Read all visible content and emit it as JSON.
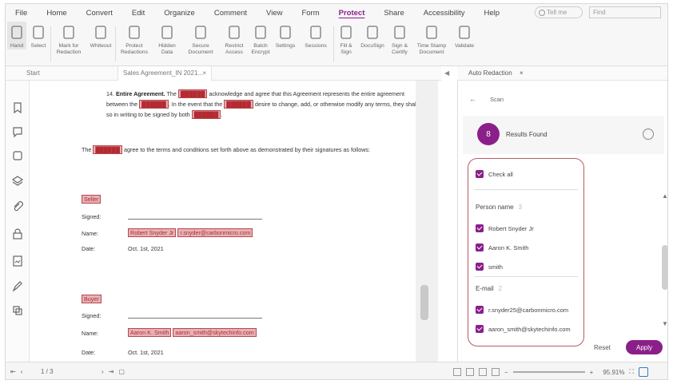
{
  "menu": [
    "File",
    "Home",
    "Convert",
    "Edit",
    "Organize",
    "Comment",
    "View",
    "Form",
    "Protect",
    "Share",
    "Accessibility",
    "Help"
  ],
  "menu_active": "Protect",
  "search_pill": "Tell me",
  "find_placeholder": "Find",
  "toolbar": [
    {
      "label": "Hand",
      "name": "hand-tool"
    },
    {
      "label": "Select",
      "name": "select-tool"
    },
    {
      "label": "Mark for\nRedaction",
      "name": "mark-redaction-tool"
    },
    {
      "label": "Whiteout",
      "name": "whiteout-tool"
    },
    {
      "label": "Protect\nRedactions",
      "name": "protect-redactions-tool"
    },
    {
      "label": "Hidden\nData",
      "name": "hidden-data-tool"
    },
    {
      "label": "Secure\nDocument",
      "name": "secure-document-tool"
    },
    {
      "label": "Restrict\nAccess",
      "name": "restrict-access-tool"
    },
    {
      "label": "Batch\nEncrypt",
      "name": "batch-encrypt-tool"
    },
    {
      "label": "Settings",
      "name": "settings-tool"
    },
    {
      "label": "Sessions",
      "name": "sessions-tool"
    },
    {
      "label": "Fill &\nSign",
      "name": "fill-sign-tool"
    },
    {
      "label": "DocuSign",
      "name": "docusign-tool"
    },
    {
      "label": "Sign &\nCertify",
      "name": "sign-certify-tool"
    },
    {
      "label": "Time Stamp\nDocument",
      "name": "time-stamp-tool"
    },
    {
      "label": "Validate",
      "name": "validate-tool"
    }
  ],
  "tabs": {
    "start": "Start",
    "doc": "Sales Agreement_IN 2021...",
    "close": "×"
  },
  "document": {
    "para_num": "14.",
    "para_title": "Entire Agreement.",
    "para_t1": " The ",
    "para_r1": "██████",
    "para_t2": " acknowledge and agree that this Agreement represents the entire agreement between the ",
    "para_r2": "██████",
    "para_t3": ". In the event that the ",
    "para_r3": "██████",
    "para_t4": " desire to change, add, or otherwise modify any terms, they shall do so in writing to be signed by both ",
    "para_r4": "██████",
    "para_t5": ".",
    "agree_t1": "The ",
    "agree_r1": "██████",
    "agree_t2": " agree to the terms and conditions set forth above as demonstrated by their signatures as follows:",
    "seller_title": "Seller",
    "seller_signed": "Signed:",
    "seller_name_label": "Name:",
    "seller_name": "Robert Snyder Jr",
    "seller_email": "r.snyder@carbonmicro.com",
    "seller_date_label": "Date:",
    "seller_date": "Oct. 1st, 2021",
    "buyer_title": "Buyer",
    "buyer_signed": "Signed:",
    "buyer_name_label": "Name:",
    "buyer_name": "Aaron K. Smith",
    "buyer_email": "aaron_smith@skytechinfo.com",
    "buyer_date_label": "Date:",
    "buyer_date": "Oct. 1st, 2021"
  },
  "pane": {
    "tab_title": "Auto Redaction",
    "tab_close": "×",
    "back_label": "Scan",
    "avatar": "8",
    "results": "Results Found",
    "check_all": "Check all",
    "groups": [
      {
        "title": "Person name",
        "count": "3",
        "items": [
          "Robert Snyder Jr",
          "Aaron K. Smith",
          "smith"
        ]
      },
      {
        "title": "E-mail",
        "count": "2",
        "items": [
          "r.snyder25@carbonmicro.com",
          "aaron_smith@skytechinfo.com"
        ]
      }
    ],
    "reset": "Reset",
    "apply": "Apply"
  },
  "status": {
    "page": "1 / 3",
    "zoom": "95.91%"
  }
}
